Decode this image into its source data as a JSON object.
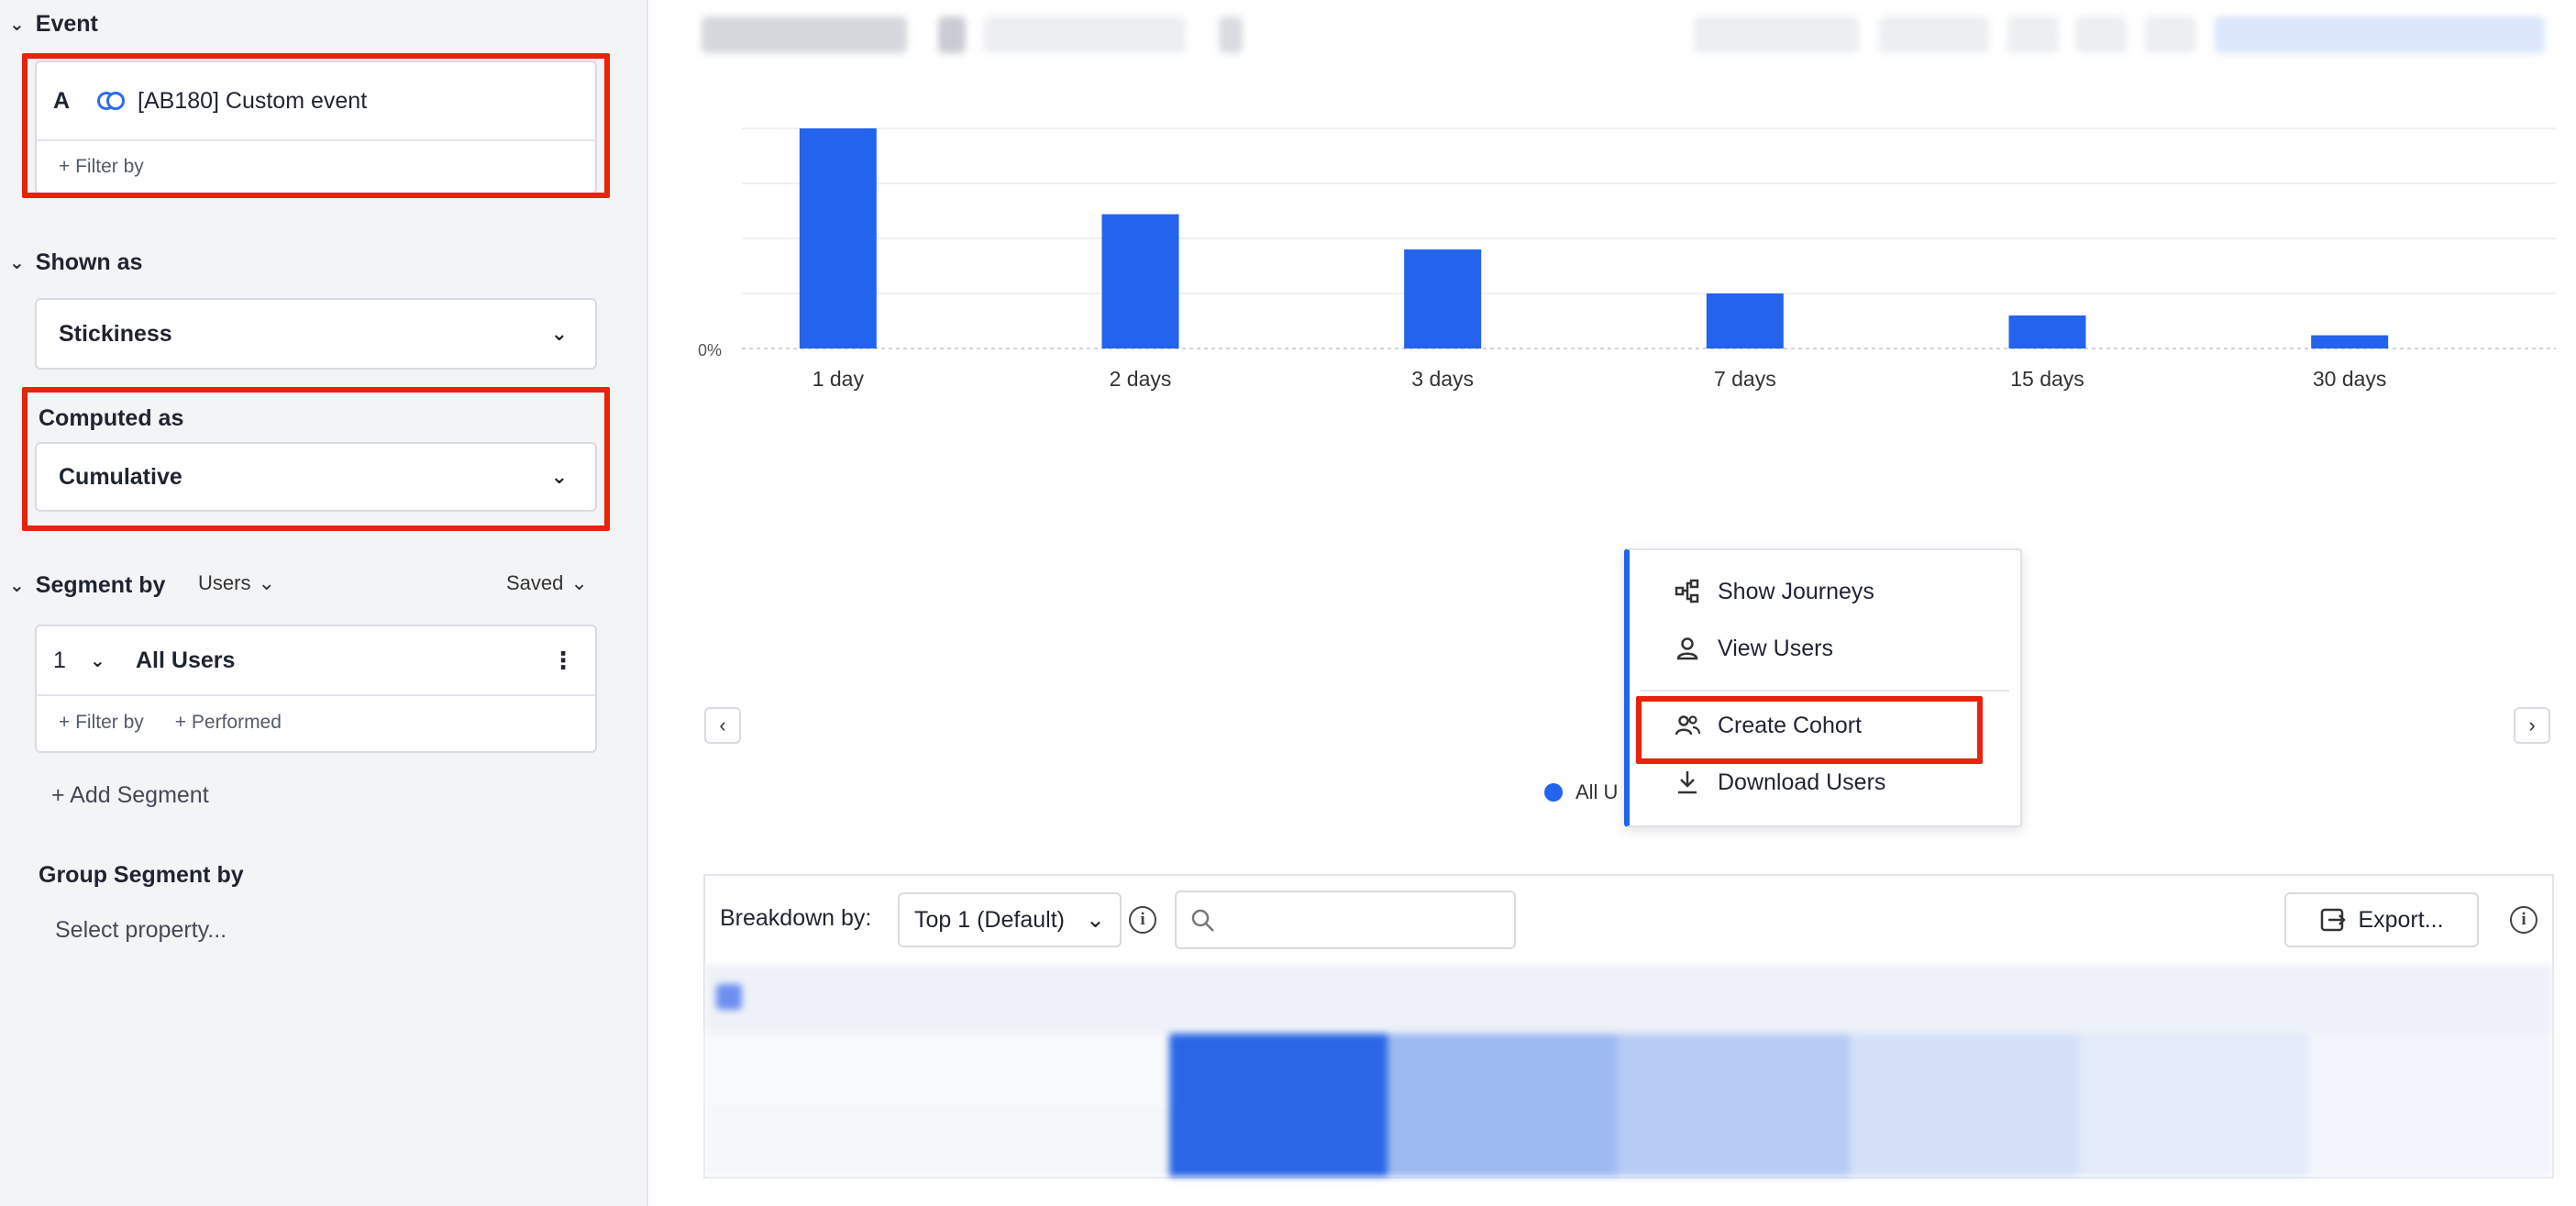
{
  "sidebar": {
    "event_section": {
      "title": "Event",
      "letter": "A",
      "event_name": "[AB180] Custom event",
      "filter": "+ Filter by"
    },
    "shown_as": {
      "title": "Shown as",
      "value": "Stickiness"
    },
    "computed_as": {
      "title": "Computed as",
      "value": "Cumulative"
    },
    "segment": {
      "title": "Segment by",
      "users_dropdown": "Users",
      "saved_dropdown": "Saved",
      "row_number": "1",
      "row_name": "All Users",
      "filter": "+ Filter by",
      "performed": "+ Performed",
      "add_segment": "+ Add Segment"
    },
    "group_segment": {
      "title": "Group Segment by",
      "placeholder": "Select property..."
    }
  },
  "chart_data": {
    "type": "bar",
    "categories": [
      "1 day",
      "2 days",
      "3 days",
      "7 days",
      "15 days",
      "30 days"
    ],
    "values": [
      100,
      61,
      45,
      25,
      15,
      6
    ],
    "ylim": [
      0,
      100
    ],
    "y_ticks": [
      "0%"
    ],
    "color": "#2463eb",
    "legend_position": "bottom"
  },
  "legend": {
    "label": "All U"
  },
  "context_menu": {
    "items": [
      {
        "label": "Show Journeys",
        "icon": "journey-icon"
      },
      {
        "label": "View Users",
        "icon": "user-icon"
      },
      {
        "label": "Create Cohort",
        "icon": "cohort-icon"
      },
      {
        "label": "Download Users",
        "icon": "download-icon"
      }
    ]
  },
  "breakdown": {
    "label": "Breakdown by:",
    "select_value": "Top 1 (Default)",
    "export_label": "Export..."
  },
  "colors": {
    "accent": "#2463eb",
    "highlight": "#e8220c"
  }
}
